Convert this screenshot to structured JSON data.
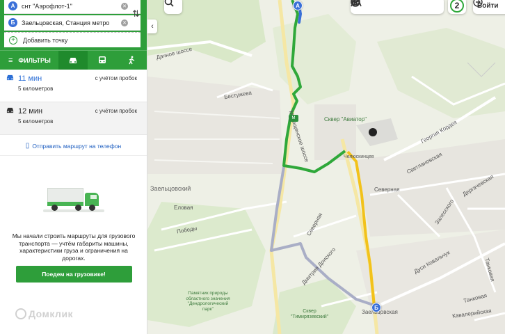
{
  "route_panel": {
    "from": {
      "badge": "A",
      "value": "снт \"Аэрофлот-1\""
    },
    "to": {
      "badge": "Б",
      "value": "Заельцовская, Станция метро"
    },
    "add_point_label": "Добавить точку",
    "clear_icon": "clear-icon",
    "swap_icon": "swap-icon"
  },
  "mode_bar": {
    "filters_label": "ФИЛЬТРЫ",
    "tabs": [
      {
        "name": "car",
        "icon": "car-icon",
        "active": true
      },
      {
        "name": "transit",
        "icon": "bus-icon",
        "active": false
      },
      {
        "name": "walk",
        "icon": "pedestrian-icon",
        "active": false
      }
    ]
  },
  "routes": [
    {
      "time": "11 мин",
      "distance": "5 километров",
      "traffic": "с учётом пробок"
    },
    {
      "time": "12 мин",
      "distance": "5 километров",
      "traffic": "с учётом пробок"
    }
  ],
  "send_to_phone": "Отправить маршрут на телефон",
  "truck_promo": {
    "text": "Мы начали строить маршруты для грузового транспорта — учтём габариты машины, характеристики груза и ограничения на дорогах.",
    "button": "Поедем на грузовике!"
  },
  "watermark": "Домклик",
  "map": {
    "labels": {
      "dinnoe": "Дачное шоссе",
      "bestuzheva": "Бестужева",
      "mochishchenskoe": "Мочищенское шоссе",
      "aviator": "Сквер \"Авиатор\"",
      "kordeya": "Георгия Кордея",
      "sevastopolskaya": "Светлановская",
      "artelnaya": "Дергачевская",
      "severnaya": "Северная",
      "zaeltsovsky": "Заельцовский",
      "elovaya": "Еловая",
      "pobedy": "Победы",
      "severnaya2": "Северная",
      "zalesskogo": "Залесского",
      "dachnaya": "Дуси Ковальчук",
      "dvortsov": "Дмитрия Донского",
      "tankovaya": "Танковая",
      "tankovaya2": "Танковая",
      "kavaleriyskaya": "Кавалерийская",
      "monument": "Памятник природы областного значения \"Дендрологический парк\"",
      "timiryazevsky": "Сквер \"Тимирязевский\"",
      "zaeltsovskaya": "Заельцовская",
      "morskaya": "Мочищенское",
      "chelyuskintsev": "Челюскинцев"
    },
    "pins": {
      "start": "A",
      "end": "Б"
    },
    "controls": {
      "search_icon": "search-icon",
      "collapse_icon": "chevron-left-icon",
      "layer_icons": [
        "pedestrian-icon",
        "mountain-icon",
        "bus-icon",
        "parking-icon",
        "layers-icon"
      ],
      "traffic_score": "2",
      "login_label": "Войти"
    },
    "colors": {
      "main_route": "#2fa83a",
      "start_segment": "#3a6fd8",
      "traffic_segment": "#f2c21b",
      "alt_route": "#a9aec6"
    }
  }
}
